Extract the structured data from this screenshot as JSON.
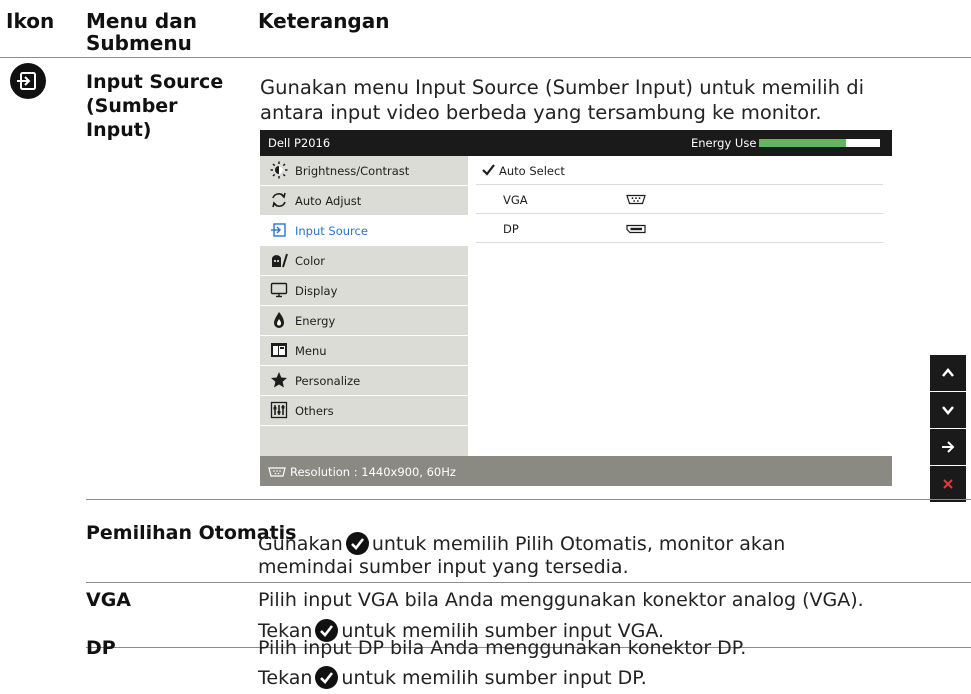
{
  "headers": {
    "icon": "Ikon",
    "menu": "Menu dan Submenu",
    "desc": "Keterangan"
  },
  "input_source": {
    "icon": "input-source-icon",
    "label": "Input Source (Sumber Input)",
    "desc": "Gunakan menu Input Source (Sumber Input) untuk memilih di antara input video berbeda yang tersambung ke monitor."
  },
  "osd": {
    "model": "Dell P2016",
    "energy_label": "Energy Use",
    "energy_level": 0.72,
    "menu_items": [
      {
        "label": "Brightness/Contrast",
        "icon": "brightness-icon"
      },
      {
        "label": "Auto Adjust",
        "icon": "auto-adjust-icon"
      },
      {
        "label": "Input Source",
        "icon": "input-source-icon"
      },
      {
        "label": "Color",
        "icon": "color-icon"
      },
      {
        "label": "Display",
        "icon": "display-icon"
      },
      {
        "label": "Energy",
        "icon": "energy-icon"
      },
      {
        "label": "Menu",
        "icon": "menu-icon"
      },
      {
        "label": "Personalize",
        "icon": "star-icon"
      },
      {
        "label": "Others",
        "icon": "others-icon"
      }
    ],
    "active_index": 2,
    "options": [
      {
        "label": "Auto Select",
        "checked": true,
        "icon": ""
      },
      {
        "label": "VGA",
        "checked": false,
        "icon": "vga-connector-icon"
      },
      {
        "label": "DP",
        "checked": false,
        "icon": "dp-connector-icon"
      }
    ],
    "resolution": "Resolution : 1440x900, 60Hz",
    "accent_color": "#2b73c9",
    "energy_color": "#5fb760"
  },
  "side_buttons": [
    {
      "name": "up-button",
      "glyph": "^"
    },
    {
      "name": "down-button",
      "glyph": "v"
    },
    {
      "name": "enter-button",
      "glyph": "→"
    },
    {
      "name": "exit-button",
      "glyph": "×"
    }
  ],
  "rows": {
    "auto": {
      "label": "Pemilihan Otomatis",
      "desc_before": "Gunakan",
      "desc_after": "untuk memilih Pilih Otomatis, monitor akan memindai sumber input yang tersedia."
    },
    "vga": {
      "label": "VGA",
      "line1": "Pilih input VGA bila Anda menggunakan konektor analog (VGA).",
      "line2_before": "Tekan",
      "line2_after": "untuk memilih sumber input VGA."
    },
    "dp": {
      "label": "DP",
      "line1": "Pilih input DP bila Anda menggunakan konektor DP.",
      "line2_before": "Tekan",
      "line2_after": "untuk memilih sumber input DP."
    }
  }
}
